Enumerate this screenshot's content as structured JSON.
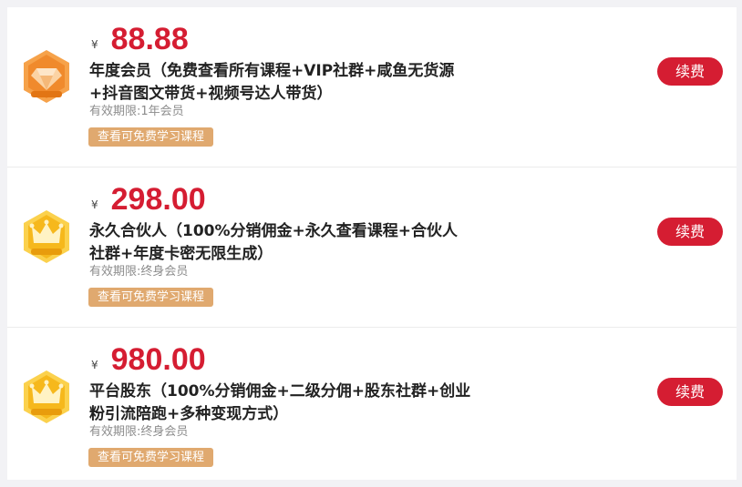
{
  "colors": {
    "accent_red": "#d51d32",
    "tag_orange": "#e0a96f",
    "badge_diamond": "#f08a2c",
    "badge_crown": "#f6b81c"
  },
  "plans": [
    {
      "badge_icon": "diamond-badge-icon",
      "currency": "¥",
      "price": "88.88",
      "title_line1": "年度会员（免费查看所有课程+VIP社群+咸鱼无货源",
      "title_line2": "+抖音图文带货+视频号达人带货）",
      "validity": "有效期限:1年会员",
      "tag": "查看可免费学习课程",
      "renew": "续费"
    },
    {
      "badge_icon": "crown-badge-icon",
      "currency": "¥",
      "price": "298.00",
      "title_line1": "永久合伙人（100%分销佣金+永久查看课程+合伙人",
      "title_line2": "社群+年度卡密无限生成）",
      "validity": "有效期限:终身会员",
      "tag": "查看可免费学习课程",
      "renew": "续费"
    },
    {
      "badge_icon": "crown-badge-icon",
      "currency": "¥",
      "price": "980.00",
      "title_line1": "平台股东（100%分销佣金+二级分佣+股东社群+创业",
      "title_line2": "粉引流陪跑+多种变现方式）",
      "validity": "有效期限:终身会员",
      "tag": "查看可免费学习课程",
      "renew": "续费"
    }
  ]
}
